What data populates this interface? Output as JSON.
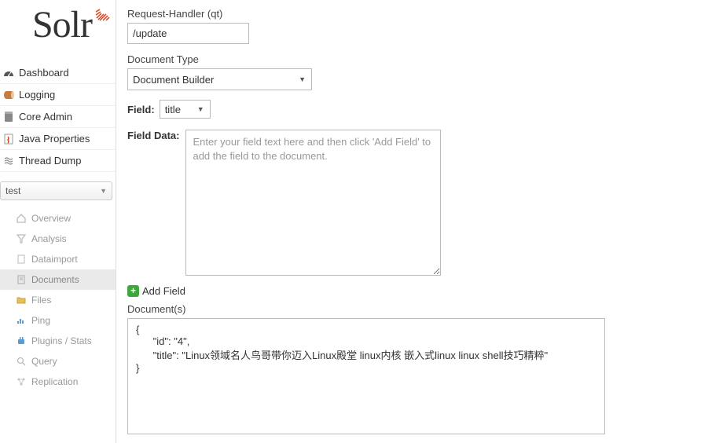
{
  "logo": {
    "text": "Solr"
  },
  "nav": {
    "items": [
      {
        "label": "Dashboard",
        "icon": "dashboard"
      },
      {
        "label": "Logging",
        "icon": "logging"
      },
      {
        "label": "Core Admin",
        "icon": "coreadmin"
      },
      {
        "label": "Java Properties",
        "icon": "javaprops"
      },
      {
        "label": "Thread Dump",
        "icon": "threaddump"
      }
    ]
  },
  "coreSelect": {
    "value": "test"
  },
  "subnav": {
    "items": [
      {
        "label": "Overview",
        "icon": "home"
      },
      {
        "label": "Analysis",
        "icon": "funnel"
      },
      {
        "label": "Dataimport",
        "icon": "page"
      },
      {
        "label": "Documents",
        "icon": "doc",
        "active": true
      },
      {
        "label": "Files",
        "icon": "folder"
      },
      {
        "label": "Ping",
        "icon": "chart"
      },
      {
        "label": "Plugins / Stats",
        "icon": "plugin"
      },
      {
        "label": "Query",
        "icon": "search"
      },
      {
        "label": "Replication",
        "icon": "replication"
      }
    ]
  },
  "form": {
    "qtLabel": "Request-Handler (qt)",
    "qtValue": "/update",
    "docTypeLabel": "Document Type",
    "docTypeValue": "Document Builder",
    "fieldLabel": "Field",
    "fieldValue": "title",
    "fieldDataLabel": "Field Data",
    "fieldDataPlaceholder": "Enter your field text here and then click 'Add Field' to add the field to the document.",
    "addFieldLabel": "Add Field",
    "documentsLabel": "Document(s)",
    "documentsContent": "{\n      \"id\": \"4\",\n      \"title\": \"Linux领域名人鸟哥带你迈入Linux殿堂 linux内核 嵌入式linux linux shell技巧精粹\"\n}"
  }
}
